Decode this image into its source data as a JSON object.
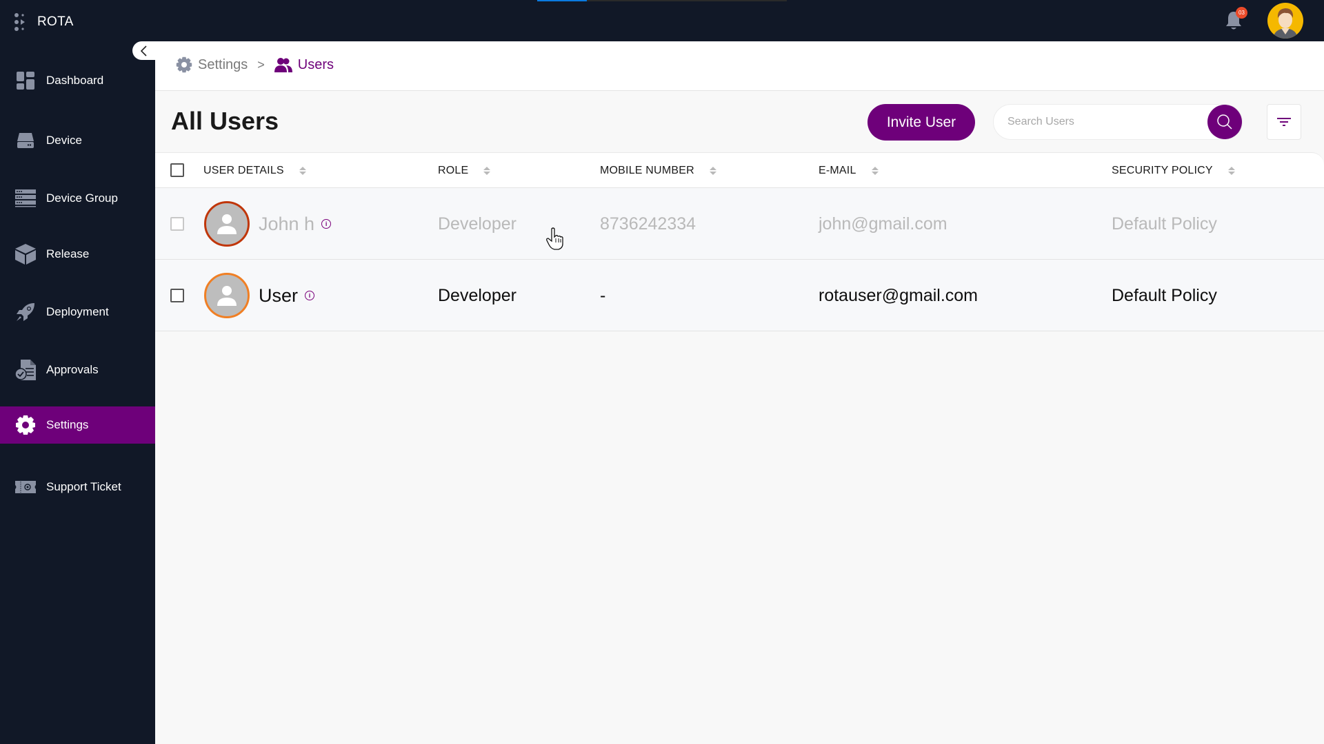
{
  "app": {
    "name": "ROTA",
    "notifications_count": "03",
    "loading_progress_percent": 20
  },
  "colors": {
    "brand_purple": "#6e007a",
    "sidebar_bg": "#111827",
    "loading_blue": "#0a7ae0",
    "badge_red": "#ea4b2a"
  },
  "sidebar": {
    "collapse_icon": "chevron-left-icon",
    "items": [
      {
        "label": "Dashboard",
        "icon": "dashboard-icon",
        "active": false
      },
      {
        "label": "Device",
        "icon": "device-icon",
        "active": false
      },
      {
        "label": "Device Group",
        "icon": "server-rack-icon",
        "active": false
      },
      {
        "label": "Release",
        "icon": "box-icon",
        "active": false
      },
      {
        "label": "Deployment",
        "icon": "rocket-icon",
        "active": false
      },
      {
        "label": "Approvals",
        "icon": "approval-document-icon",
        "active": false
      },
      {
        "label": "Settings",
        "icon": "gear-icon",
        "active": true
      },
      {
        "label": "Support Ticket",
        "icon": "ticket-icon",
        "active": false
      }
    ]
  },
  "breadcrumb": {
    "items": [
      {
        "label": "Settings",
        "icon": "gear-icon"
      },
      {
        "label": "Users",
        "icon": "users-icon"
      }
    ],
    "separator": ">"
  },
  "page": {
    "title": "All Users",
    "invite_button": "Invite User",
    "search": {
      "placeholder": "Search Users",
      "value": ""
    },
    "filter_icon": "filter-icon"
  },
  "table": {
    "columns": [
      "USER DETAILS",
      "ROLE",
      "MOBILE NUMBER",
      "E-MAIL",
      "SECURITY POLICY"
    ],
    "rows": [
      {
        "name": "John h",
        "role": "Developer",
        "mobile": "8736242334",
        "email": "john@gmail.com",
        "policy": "Default Policy",
        "state": "inactive"
      },
      {
        "name": "User",
        "role": "Developer",
        "mobile": "-",
        "email": "rotauser@gmail.com",
        "policy": "Default Policy",
        "state": "active"
      }
    ]
  }
}
